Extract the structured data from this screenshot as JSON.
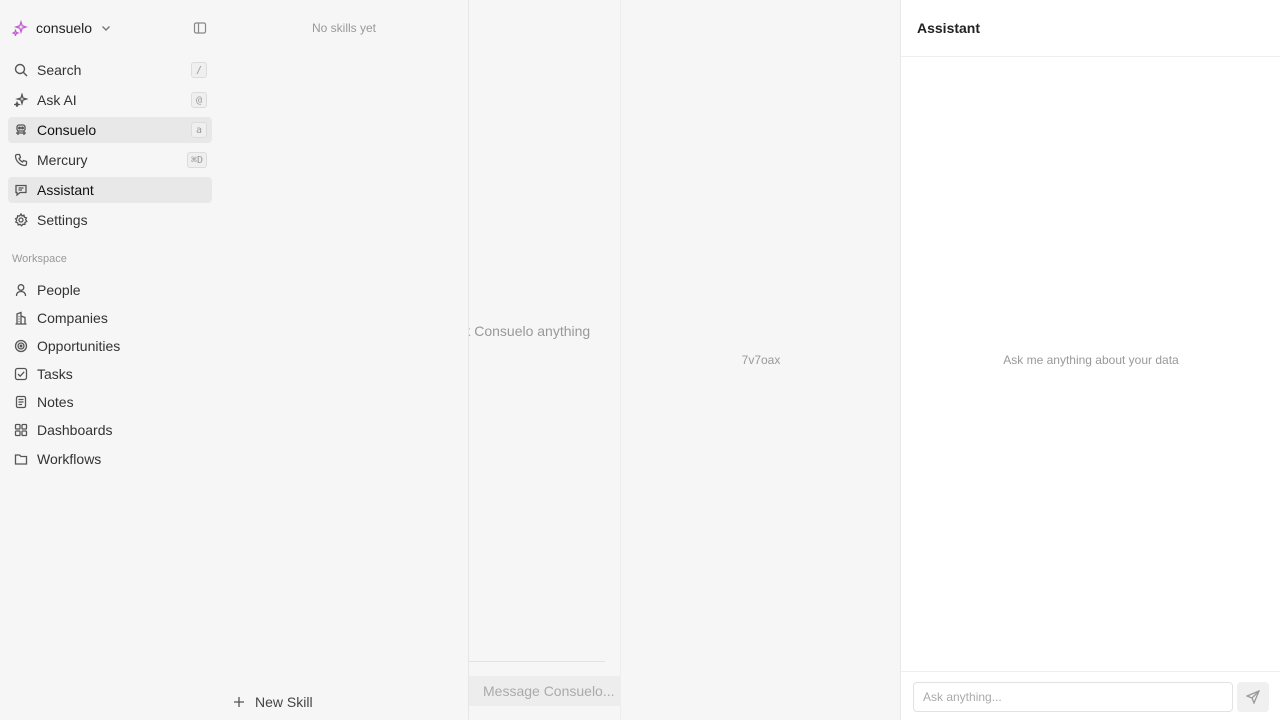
{
  "sidebar": {
    "workspace_name": "consuelo",
    "nav": [
      {
        "label": "Search",
        "shortcut": "/"
      },
      {
        "label": "Ask AI",
        "shortcut": "@"
      },
      {
        "label": "Consuelo",
        "shortcut": "a"
      },
      {
        "label": "Mercury",
        "shortcut": "⌘D"
      },
      {
        "label": "Assistant",
        "shortcut": ""
      },
      {
        "label": "Settings",
        "shortcut": ""
      }
    ],
    "section_title": "Workspace",
    "workspace_items": [
      {
        "label": "People"
      },
      {
        "label": "Companies"
      },
      {
        "label": "Opportunities"
      },
      {
        "label": "Tasks"
      },
      {
        "label": "Notes"
      },
      {
        "label": "Dashboards"
      },
      {
        "label": "Workflows"
      }
    ]
  },
  "skills": {
    "empty_text": "No skills yet",
    "new_skill_label": "New Skill"
  },
  "chat": {
    "empty_text": "Ask Consuelo anything",
    "input_placeholder": "Message Consuelo..."
  },
  "center": {
    "id_text": "7v7oax"
  },
  "assistant": {
    "title": "Assistant",
    "empty_text": "Ask me anything about your data",
    "input_placeholder": "Ask anything..."
  },
  "colors": {
    "accent_logo": "#c060d0",
    "sidebar_bg": "#f6f6f6",
    "active_item_bg": "#e8e8e8"
  }
}
